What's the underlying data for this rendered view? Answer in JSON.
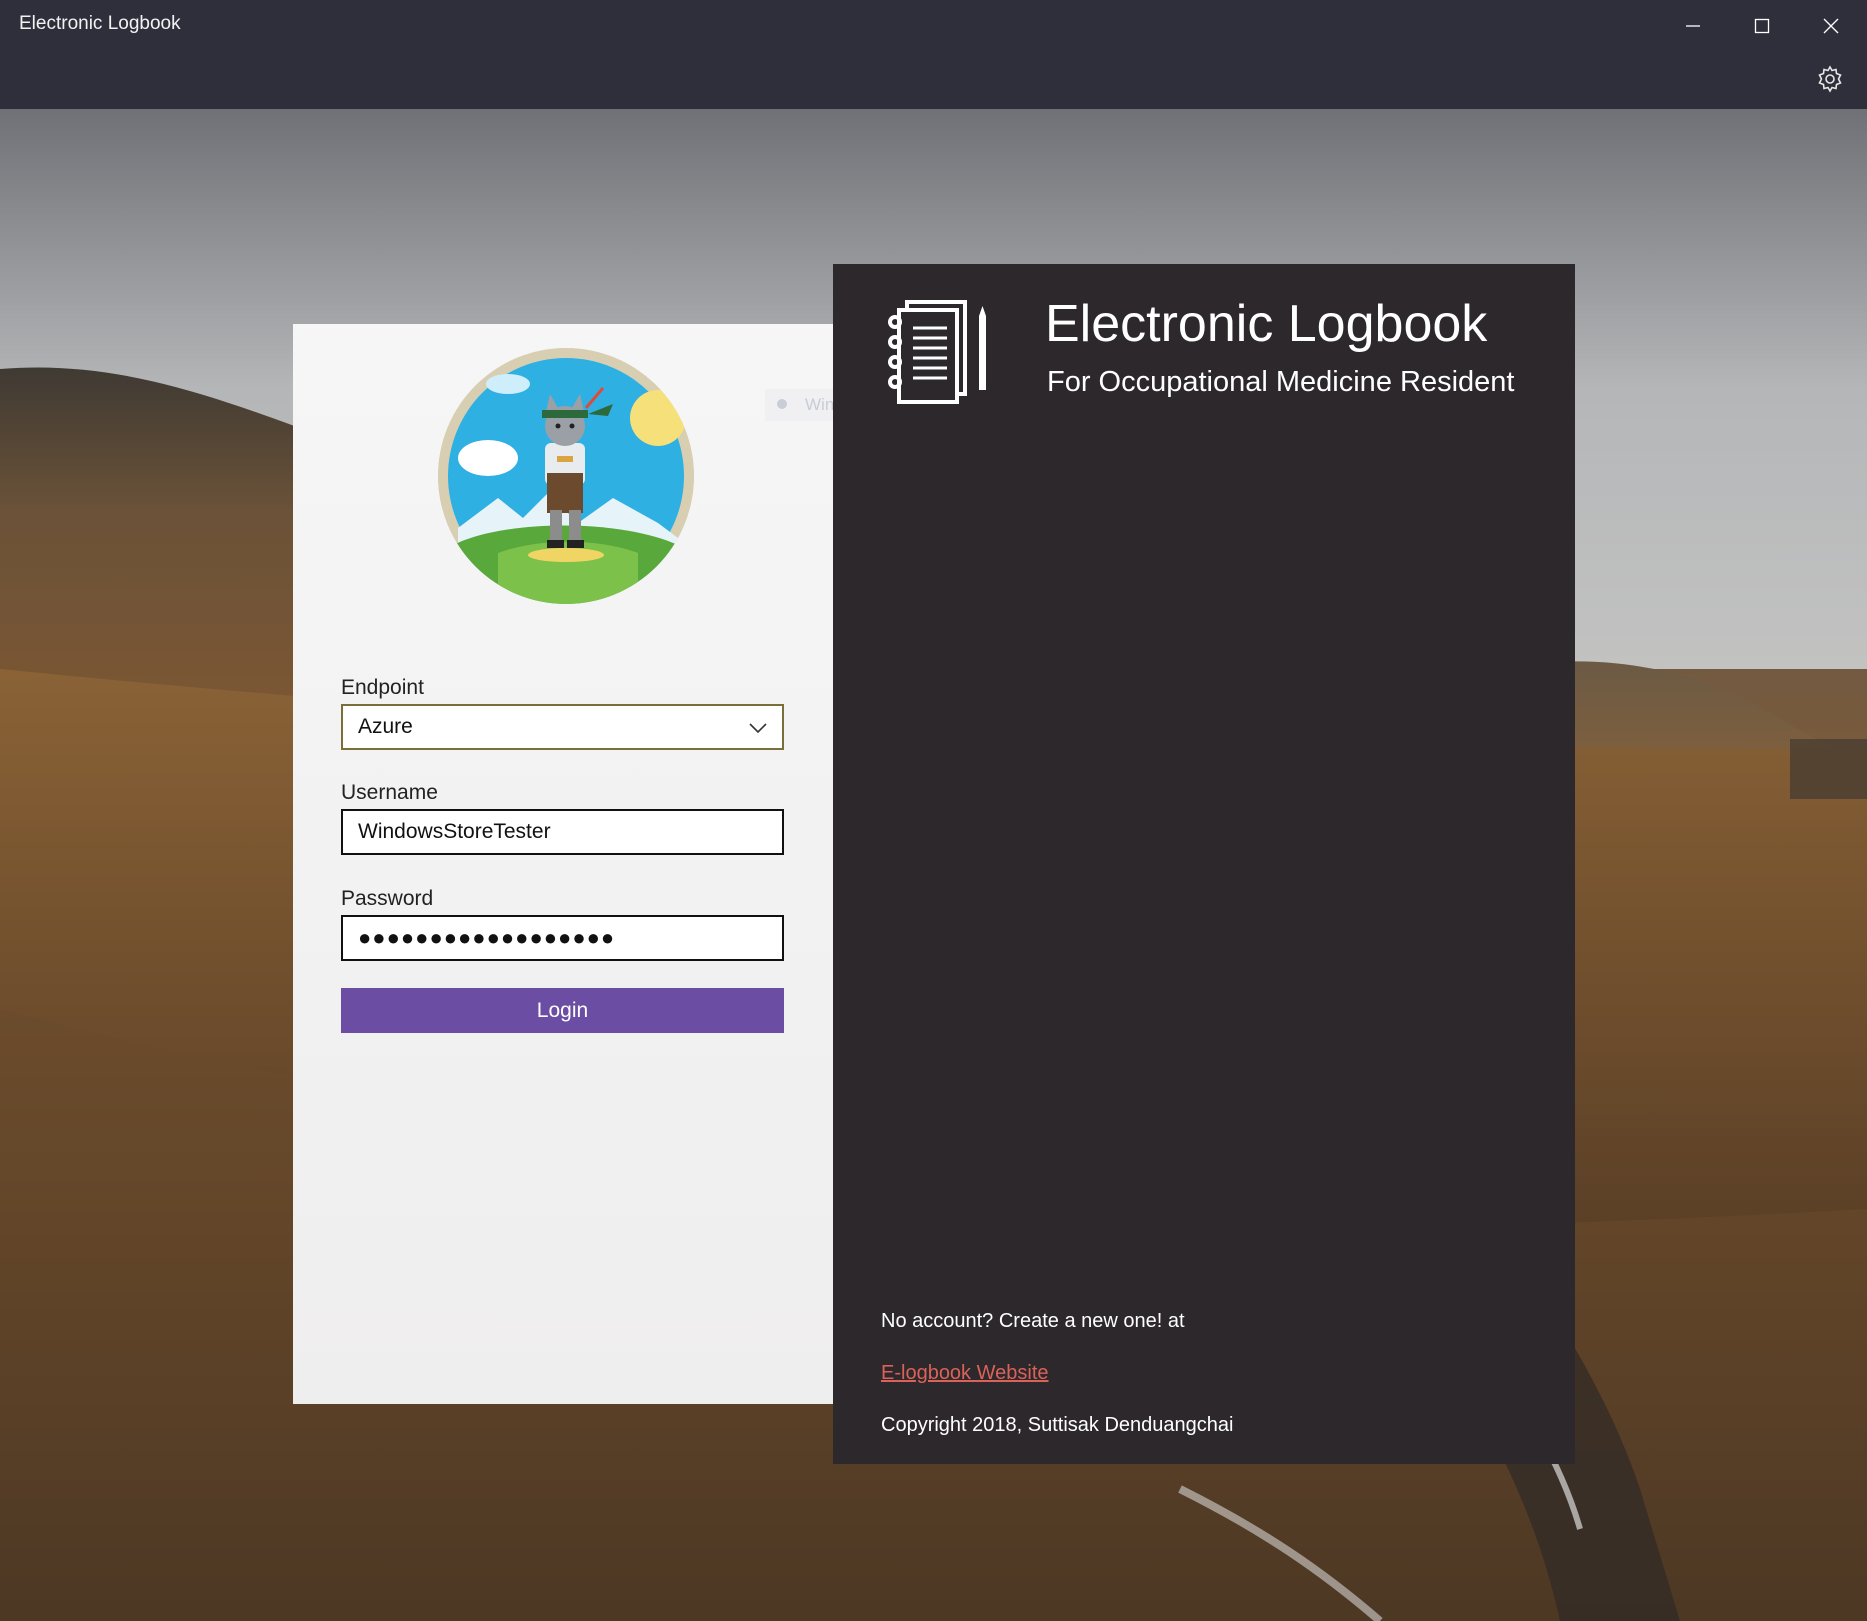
{
  "window": {
    "title": "Electronic Logbook",
    "minimize_icon": "minimize-icon",
    "maximize_icon": "maximize-icon",
    "close_icon": "close-icon",
    "settings_icon": "gear-icon"
  },
  "login": {
    "avatar_icon": "cat-mascot-avatar",
    "endpoint": {
      "label": "Endpoint",
      "value": "Azure"
    },
    "username": {
      "label": "Username",
      "value": "WindowsStoreTester"
    },
    "password": {
      "label": "Password",
      "value": "●●●●●●●●●●●●●●●●●●"
    },
    "login_button": "Login"
  },
  "overlay": {
    "snip_text": "Window Snip"
  },
  "brand": {
    "icon": "notebook-pencil-icon",
    "title": "Electronic Logbook",
    "subtitle": "For Occupational Medicine Resident",
    "no_account_text": "No account? Create a new one! at",
    "website_link": "E-logbook Website",
    "copyright": "Copyright 2018, Suttisak Denduangchai"
  },
  "colors": {
    "titlebar": "#2f2f3b",
    "login_button": "#6b4ea4",
    "brand_panel": "#2d282b",
    "link": "#d9625a"
  }
}
